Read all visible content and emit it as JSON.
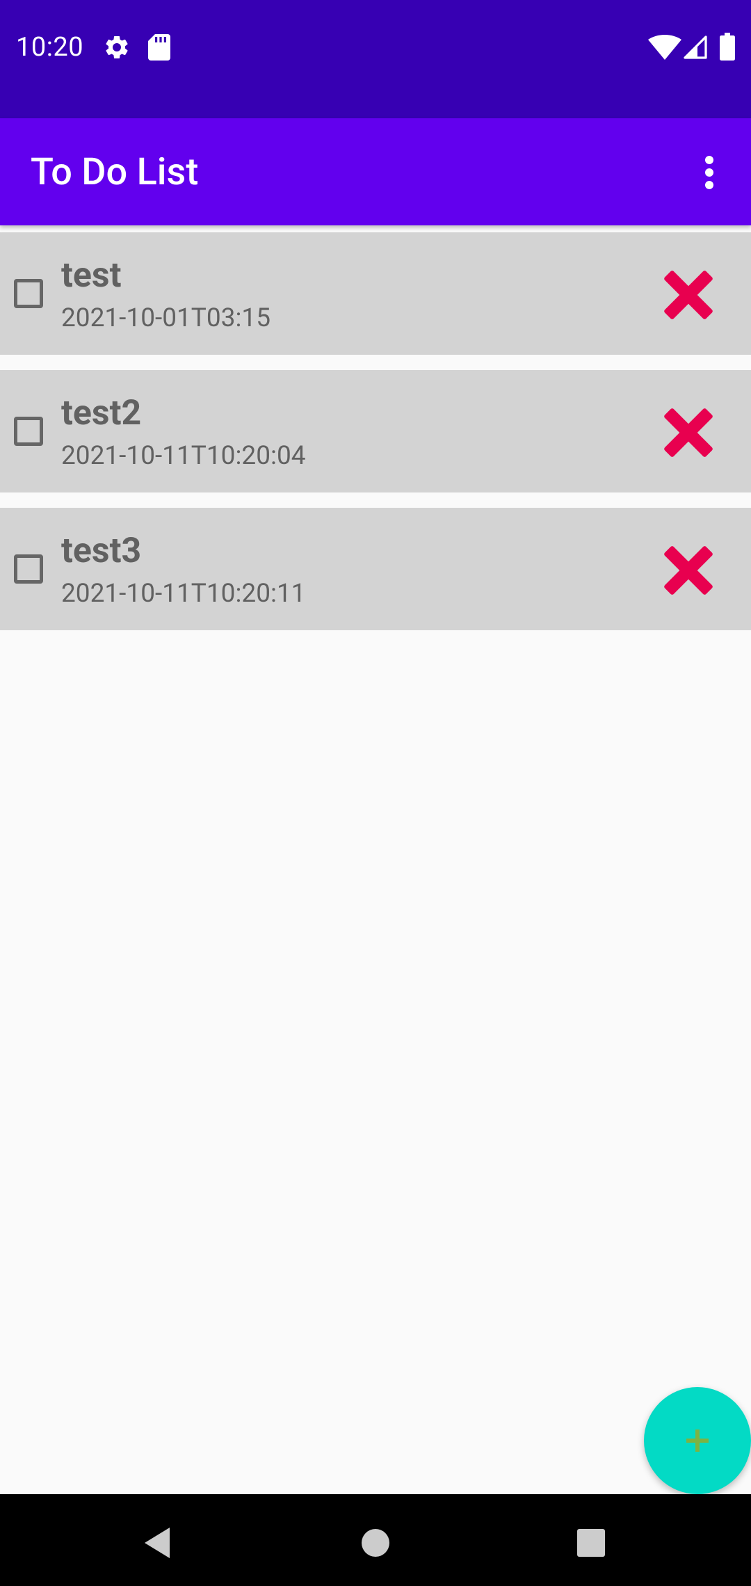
{
  "status_bar": {
    "time": "10:20",
    "icons": [
      "gear-icon",
      "sd-card-icon",
      "wifi-icon",
      "signal-icon",
      "battery-icon"
    ]
  },
  "app_bar": {
    "title": "To Do List",
    "overflow_icon": "more-vert-icon"
  },
  "todos": [
    {
      "title": "test",
      "date": "2021-10-01T03:15",
      "checked": false
    },
    {
      "title": "test2",
      "date": "2021-10-11T10:20:04",
      "checked": false
    },
    {
      "title": "test3",
      "date": "2021-10-11T10:20:11",
      "checked": false
    }
  ],
  "fab": {
    "icon": "plus-icon"
  },
  "nav_bar": {
    "icons": [
      "back-icon",
      "home-icon",
      "recents-icon"
    ]
  },
  "colors": {
    "status_bar": "#3700b3",
    "app_bar": "#6200ee",
    "row_background": "#d3d3d3",
    "delete_icon": "#e8004f",
    "fab": "#03dac5",
    "fab_plus": "#7cb342"
  }
}
